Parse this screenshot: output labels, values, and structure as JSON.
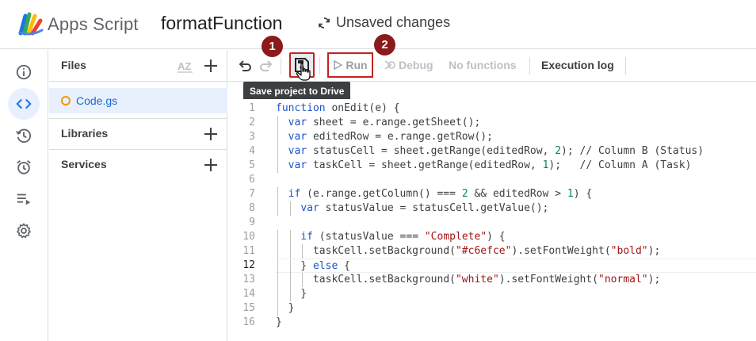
{
  "header": {
    "app_name": "Apps Script",
    "project_name": "formatFunction",
    "status": "Unsaved changes"
  },
  "rail": {
    "items": [
      {
        "name": "overview",
        "icon": "info-icon"
      },
      {
        "name": "editor",
        "icon": "code-icon",
        "active": true
      },
      {
        "name": "triggers-history",
        "icon": "history-icon"
      },
      {
        "name": "triggers",
        "icon": "alarm-icon"
      },
      {
        "name": "executions",
        "icon": "executions-icon"
      },
      {
        "name": "settings",
        "icon": "gear-icon"
      }
    ]
  },
  "files_panel": {
    "title": "Files",
    "sort_icon": "AZ",
    "files": [
      {
        "name": "Code.gs"
      }
    ],
    "libraries_label": "Libraries",
    "services_label": "Services"
  },
  "toolbar": {
    "run_label": "Run",
    "debug_label": "Debug",
    "functions_label": "No functions",
    "exec_log_label": "Execution log"
  },
  "tooltip": "Save project to Drive",
  "badges": [
    "1",
    "2"
  ],
  "colors": {
    "accent": "#1a73e8",
    "highlight_border": "#c5221f",
    "badge": "#8b1a1a",
    "keyword": "#1a55c8",
    "string": "#a31515",
    "number": "#098658"
  },
  "editor": {
    "current_line": 12,
    "lines": [
      "function onEdit(e) {",
      "  var sheet = e.range.getSheet();",
      "  var editedRow = e.range.getRow();",
      "  var statusCell = sheet.getRange(editedRow, 2); // Column B (Status)",
      "  var taskCell = sheet.getRange(editedRow, 1);   // Column A (Task)",
      "",
      "  if (e.range.getColumn() === 2 && editedRow > 1) {",
      "    var statusValue = statusCell.getValue();",
      "",
      "    if (statusValue === \"Complete\") {",
      "      taskCell.setBackground(\"#c6efce\").setFontWeight(\"bold\");",
      "    } else {",
      "      taskCell.setBackground(\"white\").setFontWeight(\"normal\");",
      "    }",
      "  }",
      "}"
    ]
  }
}
